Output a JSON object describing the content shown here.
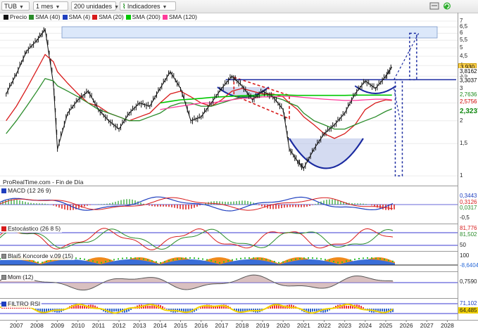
{
  "toolbar": {
    "symbol": "TUB",
    "period": "1 mes",
    "units": "200 unidades",
    "indicators": "Indicadores"
  },
  "legend_main": [
    {
      "label": "Precio",
      "color": "#111111"
    },
    {
      "label": "SMA (40)",
      "color": "#2a8c2a"
    },
    {
      "label": "SMA (4)",
      "color": "#1f3fbf"
    },
    {
      "label": "SMA (20)",
      "color": "#d81b1b"
    },
    {
      "label": "SMA (200)",
      "color": "#00c800"
    },
    {
      "label": "SMA (120)",
      "color": "#ff3a9a"
    }
  ],
  "source_note": "ProRealTime.com - Fin de Día",
  "panels": {
    "macd": "MACD (12 26 9)",
    "stoch": "Estocástico (26 8 5)",
    "koncorde": "Blai5 Koncorde v.09 (15)",
    "mom": "Mom (12)",
    "rsi": "FILTRO RSI"
  },
  "price_axis_ticks": [
    "7",
    "6,5",
    "6",
    "5,5",
    "5",
    "4,5",
    "4",
    "3,5",
    "3",
    "2,5",
    "2",
    "1,5",
    "1"
  ],
  "price_tags": [
    {
      "text": "3,930",
      "bg": "#ffd24d",
      "fg": "#000000"
    },
    {
      "text": "3,8162",
      "bg": "#ffffff",
      "fg": "#000000"
    },
    {
      "text": "3,3037",
      "bg": "#ffffff",
      "fg": "#000000"
    },
    {
      "text": "2,7636",
      "bg": "#ffffff",
      "fg": "#1a8a1a"
    },
    {
      "text": "2,5756",
      "bg": "#ffffff",
      "fg": "#cc0000"
    },
    {
      "text": "2,3237",
      "bg": "#ffffff",
      "fg": "#118811"
    }
  ],
  "macd_axis": {
    "ticks": [
      "0,3443",
      "0,3126",
      "0,0317",
      "-0,5"
    ]
  },
  "stoch_axis": {
    "ticks": [
      "81,776",
      "81,502",
      "50"
    ]
  },
  "koncorde_axis": {
    "ticks": [
      "100",
      "-8,6404"
    ]
  },
  "mom_axis": {
    "ticks": [
      "0,7590"
    ]
  },
  "rsi_axis": {
    "ticks": [
      "71,102",
      "64,485"
    ]
  },
  "x_axis_labels": [
    "2007",
    "2008",
    "2009",
    "2010",
    "2011",
    "2012",
    "2013",
    "2014",
    "2015",
    "2016",
    "2017",
    "2018",
    "2019",
    "2020",
    "2021",
    "2022",
    "2023",
    "2024",
    "2025",
    "2026",
    "2027",
    "2028"
  ],
  "chart_data": {
    "type": "line",
    "x": [
      2006.5,
      2007.0,
      2007.5,
      2008.0,
      2008.4,
      2008.8,
      2009.0,
      2009.5,
      2010.0,
      2010.5,
      2011.0,
      2011.5,
      2012.0,
      2012.5,
      2013.0,
      2013.5,
      2014.0,
      2014.5,
      2015.0,
      2015.5,
      2016.0,
      2016.5,
      2017.0,
      2017.5,
      2018.0,
      2018.5,
      2019.0,
      2019.5,
      2020.0,
      2020.3,
      2020.7,
      2021.0,
      2021.5,
      2022.0,
      2022.5,
      2023.0,
      2023.5,
      2024.0,
      2024.5,
      2025.0,
      2025.3
    ],
    "series": [
      {
        "name": "Precio",
        "values": [
          2.8,
          3.6,
          4.8,
          5.5,
          6.3,
          3.2,
          1.4,
          2.2,
          2.6,
          2.9,
          2.3,
          2.0,
          1.8,
          2.2,
          2.5,
          2.4,
          3.0,
          3.7,
          3.0,
          2.0,
          2.1,
          2.5,
          3.0,
          3.5,
          3.1,
          2.6,
          2.9,
          2.7,
          2.3,
          1.4,
          1.2,
          1.1,
          1.4,
          1.7,
          1.9,
          2.2,
          2.8,
          3.3,
          3.0,
          3.5,
          3.93
        ]
      },
      {
        "name": "SMA (20)",
        "values": [
          2.0,
          2.4,
          3.0,
          3.8,
          4.6,
          4.2,
          3.7,
          3.2,
          2.8,
          2.5,
          2.4,
          2.2,
          2.1,
          2.0,
          2.1,
          2.2,
          2.5,
          2.8,
          2.9,
          2.7,
          2.5,
          2.4,
          2.6,
          2.9,
          3.0,
          2.9,
          2.8,
          2.8,
          2.7,
          2.5,
          2.3,
          2.1,
          1.9,
          1.7,
          1.6,
          1.7,
          1.9,
          2.3,
          2.5,
          2.6,
          2.58
        ]
      },
      {
        "name": "SMA (40)",
        "values": [
          1.7,
          2.0,
          2.4,
          2.9,
          3.4,
          3.3,
          3.1,
          2.9,
          2.7,
          2.5,
          2.3,
          2.2,
          2.1,
          2.0,
          2.0,
          2.1,
          2.2,
          2.4,
          2.5,
          2.5,
          2.4,
          2.4,
          2.5,
          2.6,
          2.7,
          2.7,
          2.7,
          2.7,
          2.6,
          2.5,
          2.4,
          2.2,
          2.0,
          1.9,
          1.8,
          1.8,
          1.9,
          2.0,
          2.1,
          2.25,
          2.32
        ]
      },
      {
        "name": "SMA (120)",
        "values": [
          null,
          null,
          null,
          null,
          null,
          null,
          null,
          null,
          null,
          null,
          null,
          null,
          null,
          null,
          null,
          null,
          2.3,
          2.35,
          2.4,
          2.45,
          2.5,
          2.5,
          2.55,
          2.6,
          2.65,
          2.65,
          2.7,
          2.7,
          2.72,
          2.72,
          2.7,
          2.68,
          2.65,
          2.62,
          2.6,
          2.58,
          2.58,
          2.6,
          2.62,
          2.62,
          2.6
        ]
      },
      {
        "name": "SMA (200)",
        "values": [
          null,
          null,
          null,
          null,
          null,
          null,
          null,
          null,
          null,
          null,
          null,
          null,
          null,
          null,
          null,
          null,
          2.5,
          2.55,
          2.6,
          2.62,
          2.65,
          2.68,
          2.7,
          2.72,
          2.74,
          2.75,
          2.76,
          2.77,
          2.77,
          2.76,
          2.75,
          2.75,
          2.75,
          2.75,
          2.75,
          2.75,
          2.76,
          2.76,
          2.76,
          2.76,
          2.76
        ]
      }
    ],
    "ylim": [
      0.9,
      7.0
    ],
    "xlim": [
      2006.2,
      2028.5
    ],
    "resistance_level": 3.35
  }
}
